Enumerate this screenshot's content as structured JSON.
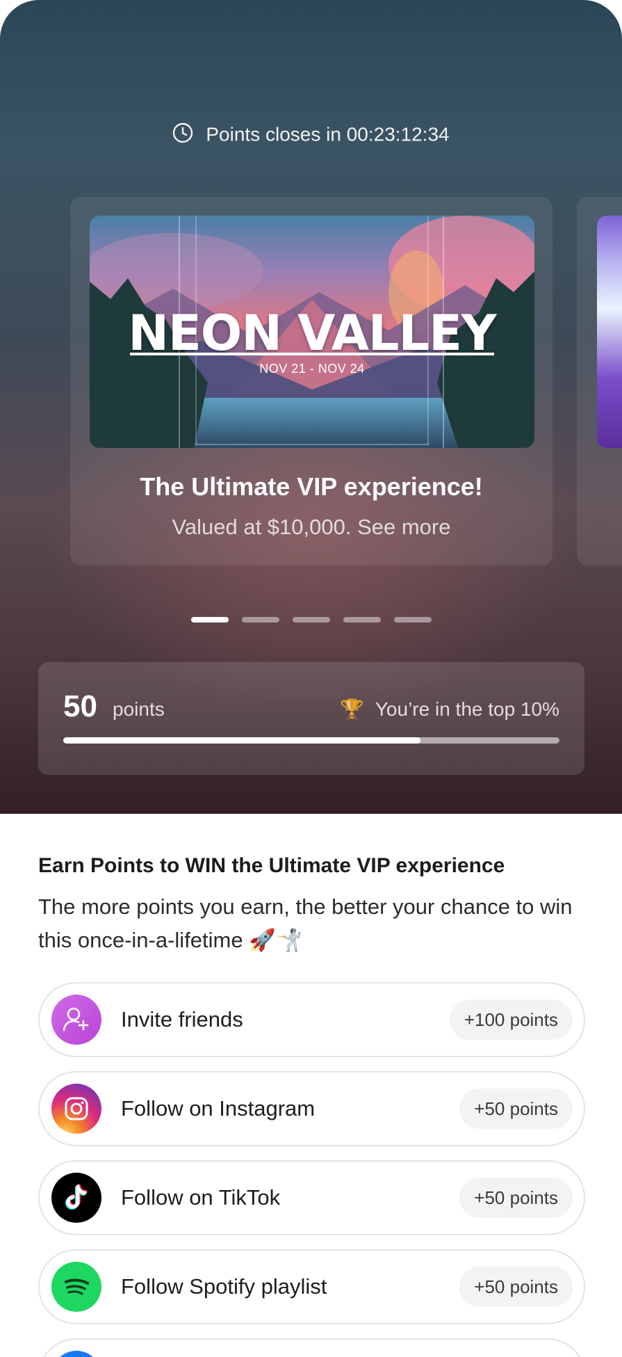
{
  "hero": {
    "timer_text": "Points closes in 00:23:12:34",
    "card": {
      "poster_title": "NEON VALLEY",
      "poster_dates": "NOV 21 - NOV 24",
      "title": "The Ultimate VIP experience!",
      "subtitle": "Valued at $10,000. See more"
    },
    "carousel": {
      "count": 5,
      "active_index": 0
    }
  },
  "points": {
    "value": "50",
    "label": "points",
    "trophy": "🏆",
    "rank_text": "You’re in the top 10%",
    "progress": 0.72
  },
  "earn": {
    "title": "Earn Points to WIN the Ultimate VIP experience",
    "description": "The more points you earn, the better your chance to win this once-in-a-lifetime 🚀🤺"
  },
  "tasks": [
    {
      "label": "Invite friends",
      "points": "+100 points",
      "icon": "add-user-icon",
      "color": "#c957e6"
    },
    {
      "label": "Follow on Instagram",
      "points": "+50 points",
      "icon": "instagram-icon",
      "color": "#e1306c"
    },
    {
      "label": "Follow on TikTok",
      "points": "+50 points",
      "icon": "tiktok-icon",
      "color": "#000000"
    },
    {
      "label": "Follow Spotify playlist",
      "points": "+50 points",
      "icon": "spotify-icon",
      "color": "#1ed760"
    }
  ],
  "colors": {
    "hero_top": "#2b4656",
    "hero_bottom": "#322025",
    "spotify": "#1ed760",
    "next_task_blue": "#1877f2"
  }
}
